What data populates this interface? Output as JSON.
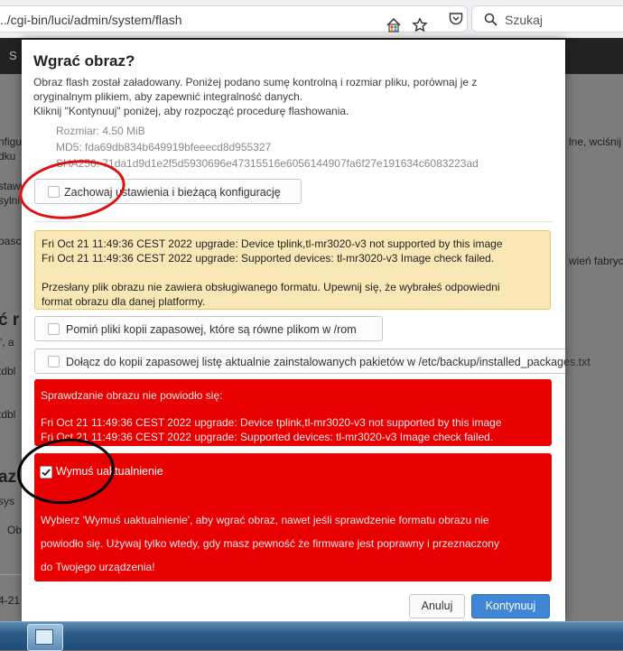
{
  "browser": {
    "url": "../cgi-bin/luci/admin/system/flash",
    "search_placeholder": "Szukaj"
  },
  "background_fragments": {
    "s_letter": "S",
    "nfig": "nfigu",
    "dku": "dku",
    "stawi": "stawi",
    "syln": "sylni",
    "pasc": "pasc",
    "c_r": "ć r",
    "quote": "\", a",
    "tdbl1": "tdbl",
    "tdbl2": "tdbl",
    "az": "az",
    "sys": "sys",
    "obj": "Ob",
    "date": "4-21",
    "right1": "lne, wciśnij",
    "right2": "wień fabryczn"
  },
  "dialog": {
    "title": "Wgrać obraz?",
    "intro_line1": "Obraz flash został załadowany. Poniżej podano sumę kontrolną i rozmiar pliku, porównaj je z",
    "intro_line2": "oryginalnym plikiem, aby zapewnić integralność danych.",
    "intro_line3": "Kliknij \"Kontynuuj\" poniżej, aby rozpocząć procedurę flashowania.",
    "size": "Rozmiar: 4.50 MiB",
    "md5": "MD5: fda69db834b649919bfeeecd8d955327",
    "sha256": "SHA256: 71da1d9d1e2f5d5930696e47315516e6056144907fa6f27e191634c6083223ad",
    "keep_settings_label": "Zachowaj ustawienia i bieżącą konfigurację",
    "warning_line1": "Fri Oct 21 11:49:36 CEST 2022 upgrade: Device tplink,tl-mr3020-v3 not supported by this image",
    "warning_line2": "Fri Oct 21 11:49:36 CEST 2022 upgrade: Supported devices: tl-mr3020-v3 Image check failed.",
    "warning_line3": "Przesłany plik obrazu nie zawiera obsługiwanego formatu. Upewnij się, że wybrałeś odpowiedni",
    "warning_line4": "format obrazu dla danej platformy.",
    "skip_backup_label": "Pomiń pliki kopii zapasowej, które są równe plikom w /rom",
    "include_packages_label": "Dołącz do kopii zapasowej listę aktualnie zainstalowanych pakietów w /etc/backup/installed_packages.txt",
    "error_title": "Sprawdzanie obrazu nie powiodło się:",
    "error_line1": "Fri Oct 21 11:49:36 CEST 2022 upgrade: Device tplink,tl-mr3020-v3 not supported by this image",
    "error_line2": "Fri Oct 21 11:49:36 CEST 2022 upgrade: Supported devices: tl-mr3020-v3 Image check failed.",
    "force_label": "Wymuś uaktualnienie",
    "force_checked": true,
    "force_desc1": "Wybierz 'Wymuś uaktualnienie', aby wgrać obraz, nawet jeśli sprawdzenie formatu obrazu nie",
    "force_desc2": "powiodło się. Używaj tylko wtedy, gdy masz pewność że firmware jest poprawny i przeznaczony",
    "force_desc3": "do Twojego urządzenia!",
    "cancel_label": "Anuluj",
    "continue_label": "Kontynuuj"
  },
  "colors": {
    "warning_bg": "#f9e8b5",
    "error_bg": "#e80000",
    "primary_button": "#3f86d6",
    "annotation_red": "#e01010",
    "annotation_black": "#000000"
  }
}
